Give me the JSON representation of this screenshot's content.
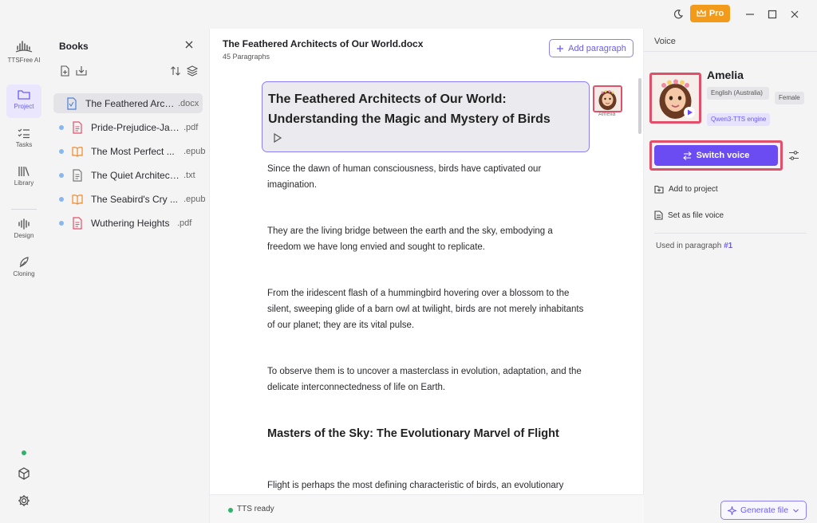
{
  "titlebar": {
    "pro_label": "Pro",
    "icons": [
      "moon-icon",
      "crown-icon",
      "minimize-icon",
      "maximize-icon",
      "close-icon"
    ]
  },
  "rail": {
    "brand": "TTSFree AI",
    "items": [
      {
        "label": "Project",
        "icon": "folder-icon",
        "active": true
      },
      {
        "label": "Tasks",
        "icon": "checklist-icon"
      },
      {
        "label": "Library",
        "icon": "library-icon"
      },
      {
        "label": "Design",
        "icon": "waveform-icon"
      },
      {
        "label": "Cloning",
        "icon": "feather-icon"
      }
    ],
    "bottom_icons": [
      "status-dot",
      "cube-icon",
      "gear-icon"
    ],
    "status_color": "#2fb36b"
  },
  "books": {
    "title": "Books",
    "items": [
      {
        "name": "The Feathered Arch...",
        "ext": ".docx",
        "icon": "docx-icon",
        "active": true
      },
      {
        "name": "Pride-Prejudice-Jan...",
        "ext": ".pdf",
        "icon": "pdf-icon"
      },
      {
        "name": "The Most Perfect ...",
        "ext": ".epub",
        "icon": "epub-icon"
      },
      {
        "name": "The Quiet Architect...",
        "ext": ".txt",
        "icon": "txt-icon"
      },
      {
        "name": "The Seabird's Cry ...",
        "ext": ".epub",
        "icon": "epub-icon"
      },
      {
        "name": "Wuthering Heights",
        "ext": ".pdf",
        "icon": "pdf-icon"
      }
    ]
  },
  "editor": {
    "doc_title": "The Feathered Architects of Our World.docx",
    "doc_subtitle": "45 Paragraphs",
    "add_paragraph": "Add paragraph",
    "heading": "The Feathered Architects of Our World: Understanding the Magic and Mystery of Birds",
    "voice_label": "Amelia",
    "paragraphs": [
      "Since the dawn of human consciousness, birds have captivated our imagination.",
      "They are the living bridge between the earth and the sky, embodying a freedom we have long envied and sought to replicate.",
      "From the iridescent flash of a hummingbird hovering over a blossom to the silent, sweeping glide of a barn owl at twilight, birds are not merely inhabitants of our planet; they are its vital pulse.",
      "To observe them is to uncover a masterclass in evolution, adaptation, and the delicate interconnectedness of life on Earth.",
      "Flight is perhaps the most defining characteristic of birds, an evolutionary"
    ],
    "subheading": "Masters of the Sky: The Evolutionary Marvel of Flight",
    "status": "TTS ready"
  },
  "voice": {
    "title": "Voice",
    "name": "Amelia",
    "language": "English (Australia)",
    "gender": "Female",
    "engine": "Qwen3-TTS engine",
    "switch_label": "Switch voice",
    "add_to_project": "Add to project",
    "set_as_file": "Set as file voice",
    "used_in_prefix": "Used in paragraph",
    "used_in_number": "#1",
    "generate": "Generate file"
  },
  "colors": {
    "accent": "#6b5cf6",
    "highlight": "#e0506a",
    "pro": "#f29a1a"
  }
}
